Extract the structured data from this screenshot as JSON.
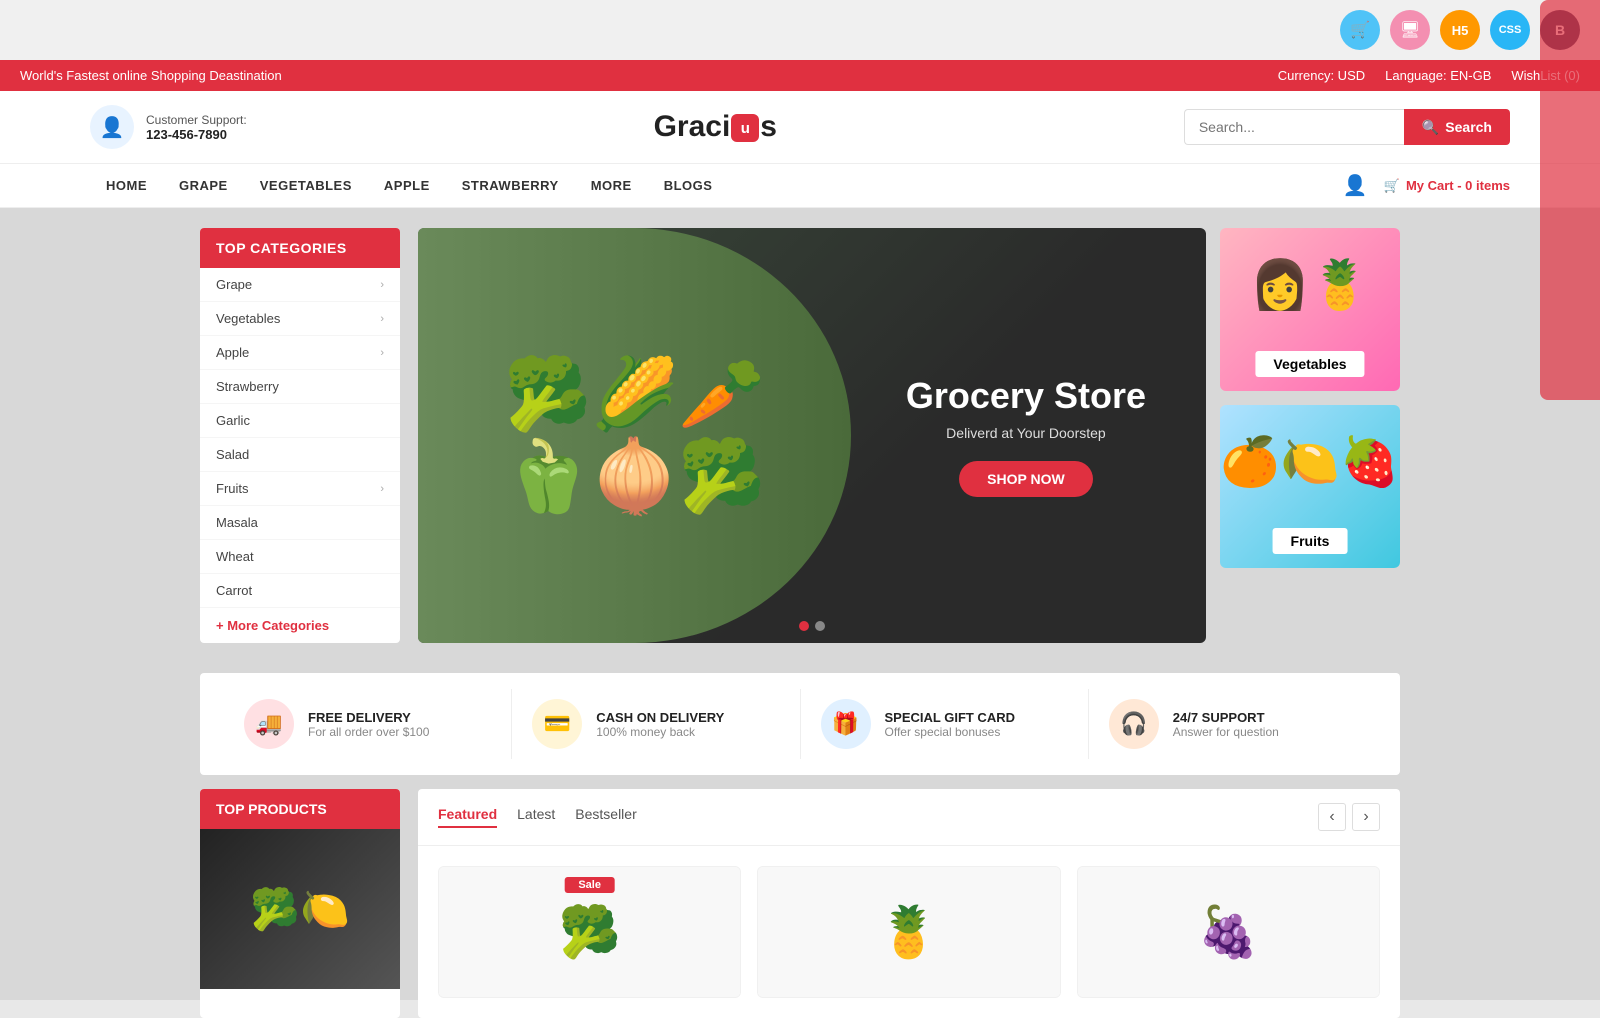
{
  "topbar": {
    "promo": "World's Fastest online Shopping Deastination",
    "currency": "Currency: USD",
    "language": "Language: EN-GB",
    "wishlist": "WishList (0)"
  },
  "header": {
    "support_label": "Customer Support:",
    "support_phone": "123-456-7890",
    "logo": "Graci",
    "logo_highlight": "u",
    "logo_suffix": "s",
    "search_placeholder": "Search...",
    "search_btn": "Search",
    "cart_label": "My Cart - 0 items"
  },
  "nav": {
    "links": [
      "HOME",
      "GRAPE",
      "VEGETABLES",
      "APPLE",
      "STRAWBERRY",
      "MORE",
      "BLOGS"
    ]
  },
  "sidebar": {
    "title": "TOP CATEGORIES",
    "items": [
      {
        "label": "Grape",
        "has_arrow": true
      },
      {
        "label": "Vegetables",
        "has_arrow": true
      },
      {
        "label": "Apple",
        "has_arrow": true
      },
      {
        "label": "Strawberry",
        "has_arrow": false
      },
      {
        "label": "Garlic",
        "has_arrow": false
      },
      {
        "label": "Salad",
        "has_arrow": false
      },
      {
        "label": "Fruits",
        "has_arrow": true
      },
      {
        "label": "Masala",
        "has_arrow": false
      },
      {
        "label": "Wheat",
        "has_arrow": false
      },
      {
        "label": "Carrot",
        "has_arrow": false
      }
    ],
    "more_label": "+ More Categories"
  },
  "hero": {
    "title": "Grocery Store",
    "subtitle": "Deliverd at Your Doorstep",
    "btn": "SHOP NOW",
    "dots": 2,
    "active_dot": 0
  },
  "banners": [
    {
      "label": "Vegetables",
      "emoji": "👩"
    },
    {
      "label": "Fruits",
      "emoji": "🍊"
    }
  ],
  "features": [
    {
      "icon": "🚚",
      "icon_class": "fi-red",
      "title": "FREE DELIVERY",
      "sub": "For all order over $100"
    },
    {
      "icon": "💳",
      "icon_class": "fi-yellow",
      "title": "CASH ON DELIVERY",
      "sub": "100% money back"
    },
    {
      "icon": "🎁",
      "icon_class": "fi-blue",
      "title": "SPECIAL GIFT CARD",
      "sub": "Offer special bonuses"
    },
    {
      "icon": "🎧",
      "icon_class": "fi-orange",
      "title": "24/7 SUPPORT",
      "sub": "Answer for question"
    }
  ],
  "products_section": {
    "sidebar_title": "TOP PRODUCTS",
    "tabs": [
      "Featured",
      "Latest",
      "Bestseller"
    ],
    "active_tab": "Featured",
    "sale_badge": "Sale",
    "products": [
      {
        "emoji": "🥦",
        "has_sale": true
      },
      {
        "emoji": "🍍",
        "has_sale": false
      },
      {
        "emoji": "🍇",
        "has_sale": false
      }
    ]
  },
  "icons_bar": {
    "icons": [
      "🛒",
      "🖥",
      "H5",
      "CSS",
      "B"
    ]
  }
}
